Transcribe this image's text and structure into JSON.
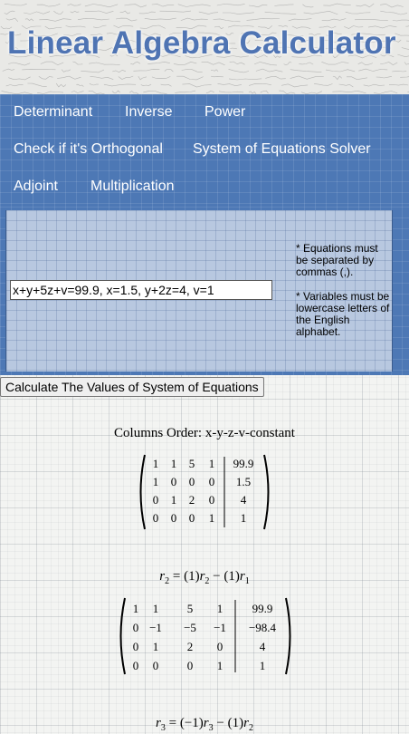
{
  "header": {
    "title": "Linear Algebra Calculator"
  },
  "nav": {
    "items": [
      "Determinant",
      "Inverse",
      "Power",
      "Check if it's Orthogonal",
      "System of Equations Solver",
      "Adjoint",
      "Multiplication"
    ]
  },
  "solver": {
    "input_value": "x+y+5z+v=99.9, x=1.5, y+2z=4, v=1",
    "note1": "* Equations must be separated by commas (,).",
    "note2": "* Variables must be lowercase letters of the English alphabet.",
    "button_label": "Calculate The Values of System of Equations"
  },
  "result": {
    "columns_label": "Columns Order:",
    "columns_order": "x-y-z-v-constant",
    "matrix1": [
      [
        "1",
        "1",
        "5",
        "1",
        "99.9"
      ],
      [
        "1",
        "0",
        "0",
        "0",
        "1.5"
      ],
      [
        "0",
        "1",
        "2",
        "0",
        "4"
      ],
      [
        "0",
        "0",
        "0",
        "1",
        "1"
      ]
    ],
    "op1": {
      "lhs": "2",
      "coef1": "(1)",
      "r1": "2",
      "coef2": "(1)",
      "r2": "1"
    },
    "matrix2": [
      [
        "1",
        "1",
        "5",
        "1",
        "99.9"
      ],
      [
        "0",
        "−1",
        "−5",
        "−1",
        "−98.4"
      ],
      [
        "0",
        "1",
        "2",
        "0",
        "4"
      ],
      [
        "0",
        "0",
        "0",
        "1",
        "1"
      ]
    ],
    "op2": {
      "lhs": "3",
      "coef1": "(−1)",
      "r1": "3",
      "coef2": "(1)",
      "r2": "2"
    }
  }
}
